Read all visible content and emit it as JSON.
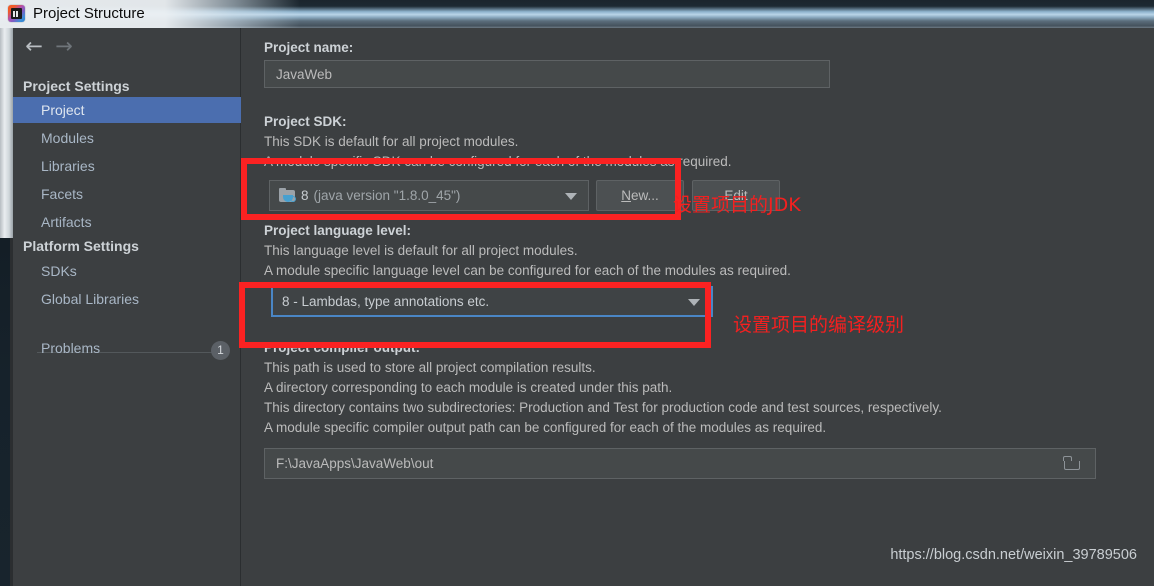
{
  "window": {
    "title": "Project Structure",
    "app_icon": "intellij-idea-icon"
  },
  "nav": {
    "back_icon": "arrow-left-icon",
    "forward_icon": "arrow-right-icon"
  },
  "sidebar": {
    "sections": [
      {
        "header": "Project Settings",
        "items": [
          {
            "label": "Project",
            "selected": true
          },
          {
            "label": "Modules",
            "selected": false
          },
          {
            "label": "Libraries",
            "selected": false
          },
          {
            "label": "Facets",
            "selected": false
          },
          {
            "label": "Artifacts",
            "selected": false
          }
        ]
      },
      {
        "header": "Platform Settings",
        "items": [
          {
            "label": "SDKs",
            "selected": false
          },
          {
            "label": "Global Libraries",
            "selected": false
          }
        ]
      }
    ],
    "problems": {
      "label": "Problems",
      "badge": "1"
    }
  },
  "main": {
    "project_name": {
      "label": "Project name:",
      "value": "JavaWeb"
    },
    "project_sdk": {
      "label": "Project SDK:",
      "description_lines": [
        "This SDK is default for all project modules.",
        "A module specific SDK can be configured for each of the modules as required."
      ],
      "selected": "8 (java version \"1.8.0_45\")",
      "selected_prefix": "8",
      "selected_suffix": "(java version \"1.8.0_45\")",
      "icon": "java-sdk-folder-icon",
      "new_button": "New...",
      "new_button_mnemonic": "N",
      "new_button_rest": "ew...",
      "edit_button": "Edit"
    },
    "language_level": {
      "label": "Project language level:",
      "description_lines": [
        "This language level is default for all project modules.",
        "A module specific language level can be configured for each of the modules as required."
      ],
      "selected": "8 - Lambdas, type annotations etc."
    },
    "compiler_output": {
      "label": "Project compiler output:",
      "description_lines": [
        "This path is used to store all project compilation results.",
        "A directory corresponding to each module is created under this path.",
        "This directory contains two subdirectories: Production and Test for production code and test sources, respectively.",
        "A module specific compiler output path can be configured for each of the modules as required."
      ],
      "value": "F:\\JavaApps\\JavaWeb\\out",
      "browse_icon": "folder-browse-icon"
    }
  },
  "annotations": {
    "sdk_note": "设置项目的JDK",
    "language_level_note": "设置项目的编译级别"
  },
  "watermark": "https://blog.csdn.net/weixin_39789506",
  "colors": {
    "dialog_bg": "#3c3f41",
    "selection_blue": "#4b6eaf",
    "focus_blue": "#4a86c5",
    "annotation_red": "#fb2222",
    "text": "#bbbbbb"
  }
}
